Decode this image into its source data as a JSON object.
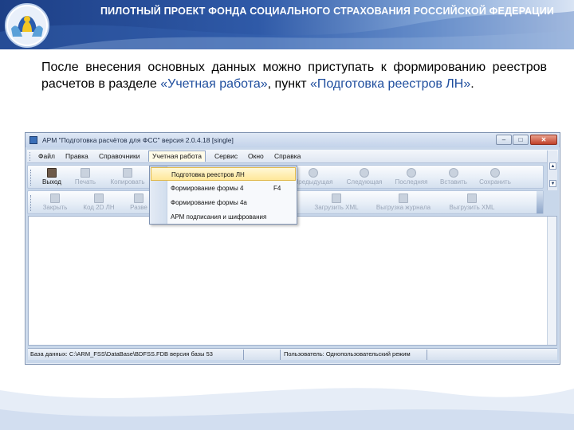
{
  "slide": {
    "header_title": "ПИЛОТНЫЙ ПРОЕКТ ФОНДА СОЦИАЛЬНОГО СТРАХОВАНИЯ РОССИЙСКОЙ ФЕДЕРАЦИИ",
    "intro_part1": "После внесения основных данных можно приступать к формированию реестров расчетов в разделе ",
    "intro_section": "«Учетная работа»",
    "intro_part2": ", пункт ",
    "intro_item": "«Подготовка реестров ЛН»",
    "intro_end": "."
  },
  "window": {
    "title": "АРМ \"Подготовка расчётов для ФСС\"   версия 2.0.4.18 [single]",
    "minimize": "–",
    "maximize": "□",
    "close": "✕"
  },
  "menubar": {
    "items": [
      "Файл",
      "Правка",
      "Справочники",
      "Учетная работа",
      "Сервис",
      "Окно",
      "Справка"
    ]
  },
  "toolbar1": {
    "items": [
      {
        "label": "Выход",
        "icon": "exit-icon",
        "enabled": true
      },
      {
        "label": "Печать",
        "icon": "print-icon",
        "enabled": false
      },
      {
        "label": "Копировать",
        "icon": "copy-icon",
        "enabled": false
      },
      {
        "label": "Предыдущая",
        "icon": "previous-icon",
        "enabled": false
      },
      {
        "label": "Следующая",
        "icon": "next-icon",
        "enabled": false
      },
      {
        "label": "Последняя",
        "icon": "last-icon",
        "enabled": false
      },
      {
        "label": "Вставить",
        "icon": "insert-icon",
        "enabled": false
      },
      {
        "label": "Сохранить",
        "icon": "save-icon",
        "enabled": false
      }
    ]
  },
  "toolbar2": {
    "items": [
      {
        "label": "Закрыть",
        "icon": "close-doc-icon"
      },
      {
        "label": "Код 2D ЛН",
        "icon": "barcode-icon"
      },
      {
        "label": "Разве",
        "icon": "expand-icon"
      },
      {
        "label": "Загрузить XML",
        "icon": "load-xml-icon"
      },
      {
        "label": "Выгрузка журнала",
        "icon": "export-log-icon"
      },
      {
        "label": "Выгрузить XML",
        "icon": "export-xml-icon"
      }
    ]
  },
  "dropdown": {
    "items": [
      {
        "label": "Подготовка реестров ЛН",
        "shortcut": ""
      },
      {
        "label": "Формирование формы 4",
        "shortcut": "F4"
      },
      {
        "label": "Формирование формы 4а",
        "shortcut": ""
      },
      {
        "label": "АРМ подписания и шифрования",
        "shortcut": ""
      }
    ]
  },
  "statusbar": {
    "database": "База данных: C:\\ARM_FSS\\DataBase\\BDFSS.FDB   версия базы 53",
    "user": "Пользователь: Однопользовательский режим"
  },
  "colors": {
    "header_dark": "#1d3f86",
    "highlight_text": "#1f4e9e",
    "menu_hover": "#ffe79a"
  }
}
